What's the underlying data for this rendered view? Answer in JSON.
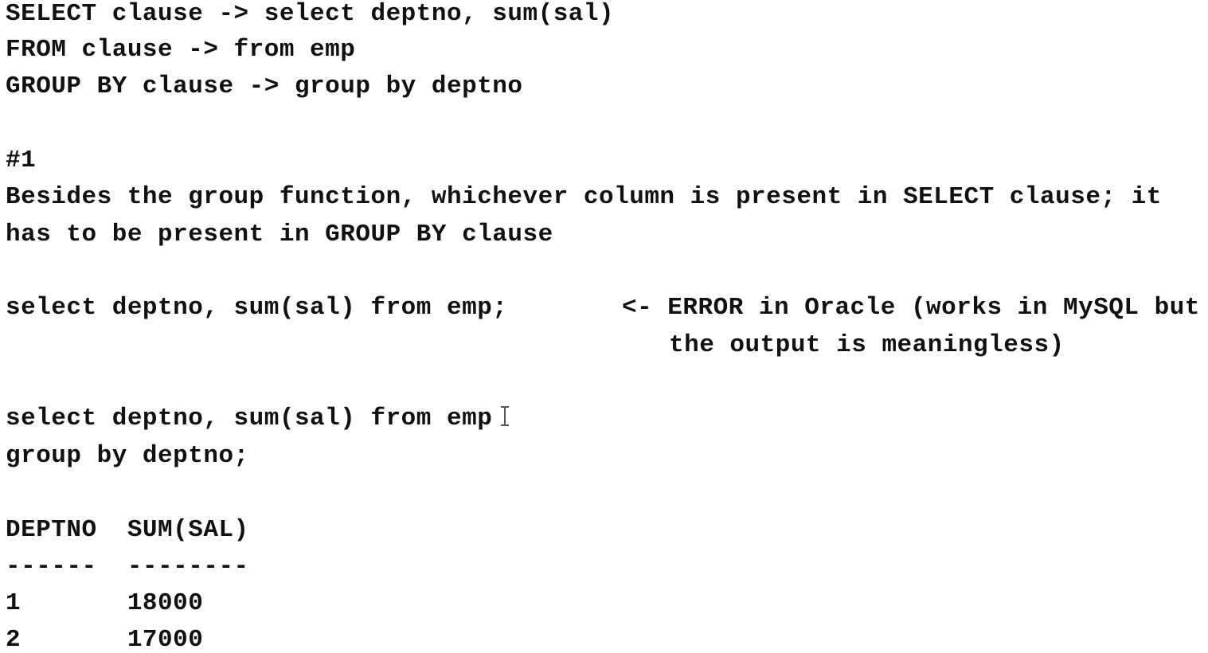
{
  "intro": {
    "line1": "SELECT clause -> select deptno, sum(sal)",
    "line2": "FROM clause -> from emp",
    "line3": "GROUP BY clause -> group by deptno"
  },
  "rule": {
    "number": "#1",
    "text_line1": "Besides the group function, whichever column is present in SELECT clause; it",
    "text_line2": "has to be present in GROUP BY clause"
  },
  "bad_query": {
    "query": "select deptno, sum(sal) from emp;",
    "comment_line1": "<- ERROR in Oracle (works in MySQL but",
    "comment_line2": "the output is meaningless)"
  },
  "good_query": {
    "line1": "select deptno, sum(sal) from emp",
    "line2": "group by deptno;"
  },
  "result": {
    "header": "DEPTNO  SUM(SAL)",
    "separator": "------  --------",
    "rows": [
      "1       18000",
      "2       17000"
    ]
  }
}
